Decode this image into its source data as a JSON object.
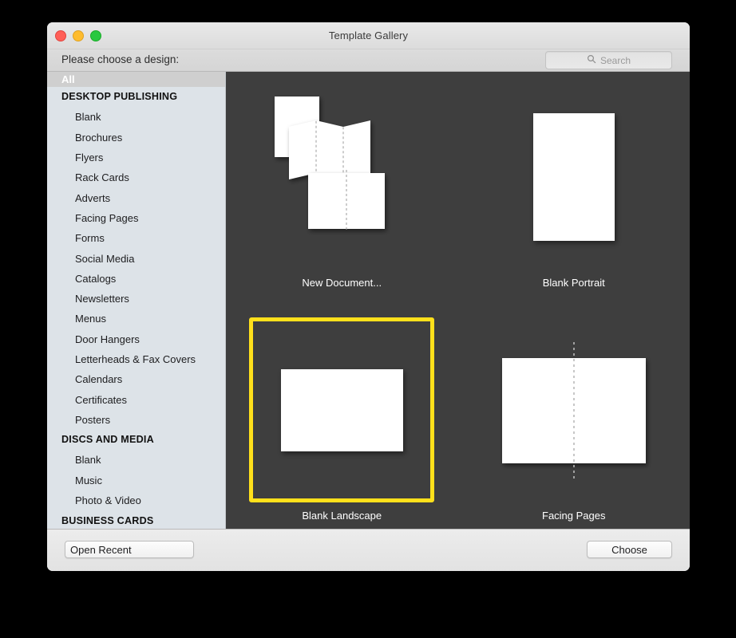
{
  "window": {
    "title": "Template Gallery",
    "prompt": "Please choose a design:",
    "traffic_lights": {
      "close_label": "close",
      "minimize_label": "minimize",
      "maximize_label": "maximize",
      "close_color": "#ff5f57",
      "minimize_color": "#febc2e",
      "maximize_color": "#28c840"
    }
  },
  "search": {
    "placeholder": "Search",
    "value": "",
    "icon": "search-icon"
  },
  "sidebar": {
    "selected": "All",
    "rows": [
      {
        "label": "All",
        "type": "selected"
      },
      {
        "label": "DESKTOP PUBLISHING",
        "type": "header"
      },
      {
        "label": "Blank",
        "type": "item"
      },
      {
        "label": "Brochures",
        "type": "item"
      },
      {
        "label": "Flyers",
        "type": "item"
      },
      {
        "label": "Rack Cards",
        "type": "item"
      },
      {
        "label": "Adverts",
        "type": "item"
      },
      {
        "label": "Facing Pages",
        "type": "item"
      },
      {
        "label": "Forms",
        "type": "item"
      },
      {
        "label": "Social Media",
        "type": "item"
      },
      {
        "label": "Catalogs",
        "type": "item"
      },
      {
        "label": "Newsletters",
        "type": "item"
      },
      {
        "label": "Menus",
        "type": "item"
      },
      {
        "label": "Door Hangers",
        "type": "item"
      },
      {
        "label": "Letterheads & Fax Covers",
        "type": "item"
      },
      {
        "label": "Calendars",
        "type": "item"
      },
      {
        "label": "Certificates",
        "type": "item"
      },
      {
        "label": "Posters",
        "type": "item"
      },
      {
        "label": "DISCS AND MEDIA",
        "type": "header"
      },
      {
        "label": "Blank",
        "type": "item"
      },
      {
        "label": "Music",
        "type": "item"
      },
      {
        "label": "Photo & Video",
        "type": "item"
      },
      {
        "label": "BUSINESS CARDS",
        "type": "header"
      }
    ]
  },
  "gallery": {
    "selected_index": 2,
    "selection_color": "#FFE01B",
    "background_color": "#3e3e3e",
    "items": [
      {
        "label": "New Document...",
        "thumb": "new-document-thumb",
        "selected": false
      },
      {
        "label": "Blank Portrait",
        "thumb": "blank-portrait-thumb",
        "selected": false
      },
      {
        "label": "Blank Landscape",
        "thumb": "blank-landscape-thumb",
        "selected": true
      },
      {
        "label": "Facing Pages",
        "thumb": "facing-pages-thumb",
        "selected": false
      }
    ]
  },
  "footer": {
    "open_recent_label": "Open Recent",
    "open_recent_options": [
      "Open Recent"
    ],
    "choose_label": "Choose"
  }
}
